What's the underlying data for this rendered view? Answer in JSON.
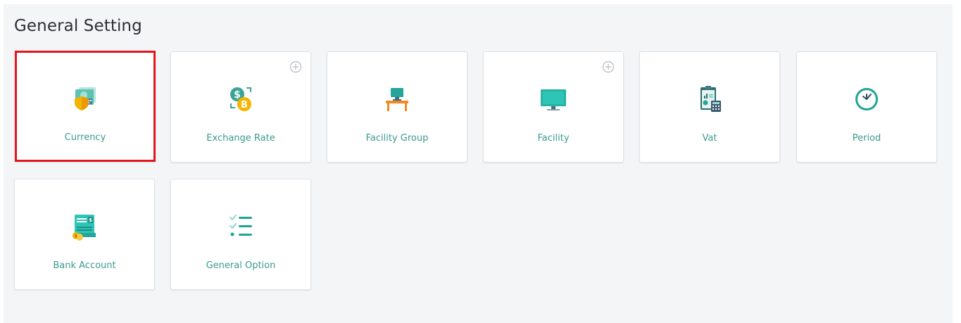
{
  "page": {
    "title": "General Setting"
  },
  "colors": {
    "accent": "#3a9a8f",
    "selected_border": "#e3171b"
  },
  "cards": [
    {
      "label": "Currency",
      "icon": "currency-shield-icon",
      "selected": true,
      "has_add": false
    },
    {
      "label": "Exchange Rate",
      "icon": "exchange-rate-icon",
      "selected": false,
      "has_add": true
    },
    {
      "label": "Facility Group",
      "icon": "facility-group-icon",
      "selected": false,
      "has_add": false
    },
    {
      "label": "Facility",
      "icon": "monitor-icon",
      "selected": false,
      "has_add": true
    },
    {
      "label": "Vat",
      "icon": "vat-calculator-icon",
      "selected": false,
      "has_add": false
    },
    {
      "label": "Period",
      "icon": "clock-icon",
      "selected": false,
      "has_add": false
    },
    {
      "label": "Bank Account",
      "icon": "bank-account-icon",
      "selected": false,
      "has_add": false
    },
    {
      "label": "General Option",
      "icon": "checklist-icon",
      "selected": false,
      "has_add": false
    }
  ]
}
